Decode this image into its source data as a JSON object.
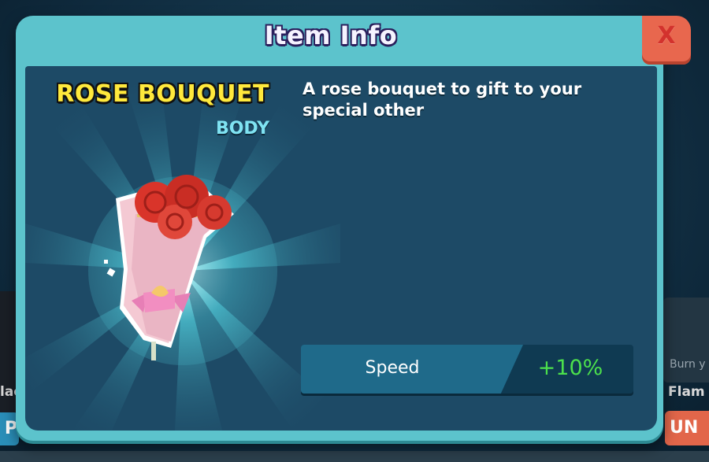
{
  "dialog": {
    "title": "Item Info",
    "close_label": "X"
  },
  "item": {
    "name": "ROSE BOUQUET",
    "type": "BODY",
    "description": "A rose bouquet to gift to your special other",
    "icon": "rose-bouquet"
  },
  "stat": {
    "label": "Speed",
    "value": "+10%"
  },
  "background": {
    "left_label": "lac",
    "left_button": "P",
    "right_caption": "Burn y",
    "right_label": "Flam",
    "right_button": "UN"
  },
  "colors": {
    "frame": "#5cc3cc",
    "panel": "#1d4a66",
    "item_name": "#ffe93c",
    "item_type": "#7fe3f2",
    "stat_value": "#4ce04c",
    "close_button": "#e8674e"
  }
}
